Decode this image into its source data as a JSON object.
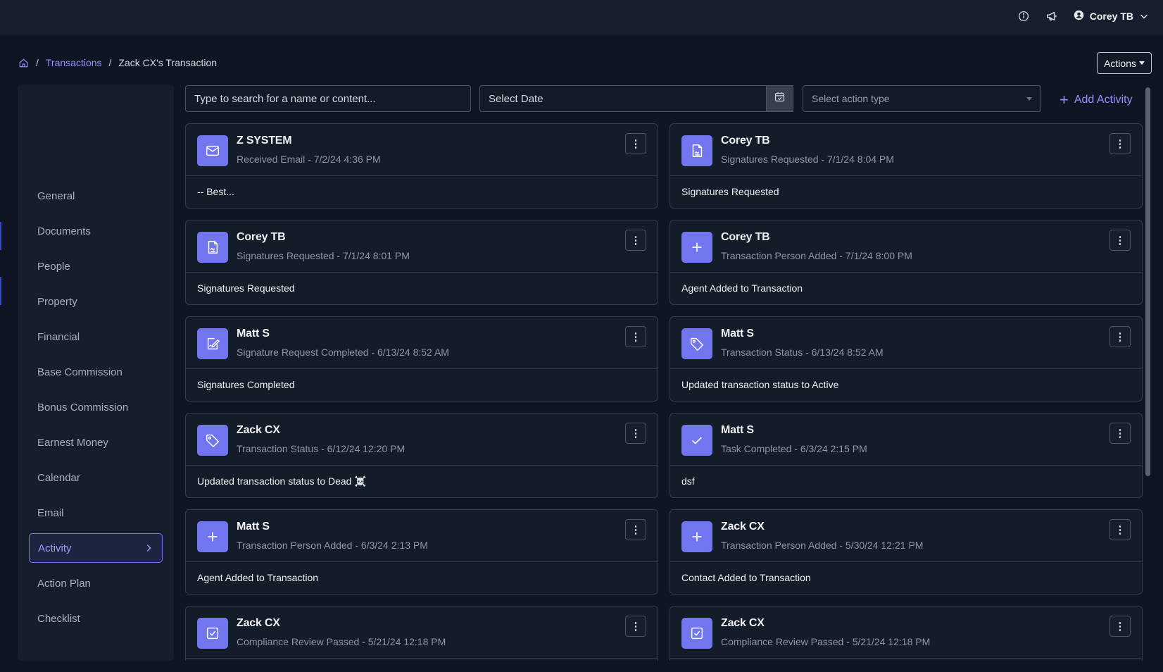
{
  "topbar": {
    "user_name": "Corey TB"
  },
  "breadcrumb": {
    "separator": "/",
    "transactions": "Transactions",
    "current": "Zack CX's Transaction"
  },
  "actions_label": "Actions",
  "sidebar": {
    "items": [
      {
        "label": "General"
      },
      {
        "label": "Documents"
      },
      {
        "label": "People"
      },
      {
        "label": "Property"
      },
      {
        "label": "Financial"
      },
      {
        "label": "Base Commission"
      },
      {
        "label": "Bonus Commission"
      },
      {
        "label": "Earnest Money"
      },
      {
        "label": "Calendar"
      },
      {
        "label": "Email"
      },
      {
        "label": "Activity",
        "active": true
      },
      {
        "label": "Action Plan"
      },
      {
        "label": "Checklist"
      }
    ]
  },
  "toolbar": {
    "search_placeholder": "Type to search for a name or content...",
    "date_label": "Select Date",
    "action_type_label": "Select action type",
    "add_activity_label": "Add Activity"
  },
  "activities": [
    {
      "icon": "envelope-icon",
      "name": "Z SYSTEM",
      "meta": "Received Email - 7/2/24 4:36 PM",
      "body": "-- Best..."
    },
    {
      "icon": "signature-document-icon",
      "name": "Corey TB",
      "meta": "Signatures Requested - 7/1/24 8:04 PM",
      "body": "Signatures Requested"
    },
    {
      "icon": "signature-document-icon",
      "name": "Corey TB",
      "meta": "Signatures Requested - 7/1/24 8:01 PM",
      "body": "Signatures Requested"
    },
    {
      "icon": "plus-icon",
      "name": "Corey TB",
      "meta": "Transaction Person Added - 7/1/24 8:00 PM",
      "body": "Agent Added to Transaction"
    },
    {
      "icon": "signature-complete-icon",
      "name": "Matt S",
      "meta": "Signature Request Completed - 6/13/24 8:52 AM",
      "body": "Signatures Completed"
    },
    {
      "icon": "tag-icon",
      "name": "Matt S",
      "meta": "Transaction Status - 6/13/24 8:52 AM",
      "body": "Updated transaction status to Active"
    },
    {
      "icon": "tag-icon",
      "name": "Zack CX",
      "meta": "Transaction Status - 6/12/24 12:20 PM",
      "body": "Updated transaction status to Dead ☠️"
    },
    {
      "icon": "checkmark-icon",
      "name": "Matt S",
      "meta": "Task Completed - 6/3/24 2:15 PM",
      "body": "dsf"
    },
    {
      "icon": "plus-icon",
      "name": "Matt S",
      "meta": "Transaction Person Added - 6/3/24 2:13 PM",
      "body": "Agent Added to Transaction"
    },
    {
      "icon": "plus-icon",
      "name": "Zack CX",
      "meta": "Transaction Person Added - 5/30/24 12:21 PM",
      "body": "Contact Added to Transaction"
    },
    {
      "icon": "checkbox-icon",
      "name": "Zack CX",
      "meta": "Compliance Review Passed - 5/21/24 12:18 PM",
      "body": ""
    },
    {
      "icon": "checkbox-icon",
      "name": "Zack CX",
      "meta": "Compliance Review Passed - 5/21/24 12:18 PM",
      "body": ""
    }
  ],
  "colors": {
    "accent": "#7176ee",
    "link": "#8f92ff",
    "background": "#0f1523"
  }
}
